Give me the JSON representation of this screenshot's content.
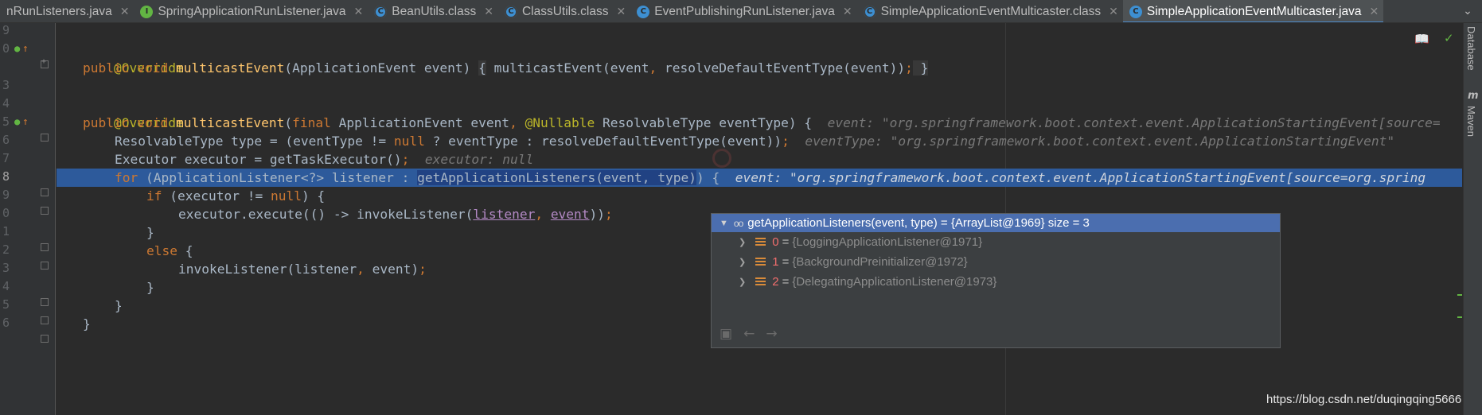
{
  "tabs": [
    {
      "label": "nRunListeners.java",
      "icon": "none"
    },
    {
      "label": "SpringApplicationRunListener.java",
      "icon": "interface-icon"
    },
    {
      "label": "BeanUtils.class",
      "icon": "class-file-icon"
    },
    {
      "label": "ClassUtils.class",
      "icon": "class-file-icon"
    },
    {
      "label": "EventPublishingRunListener.java",
      "icon": "class-icon"
    },
    {
      "label": "SimpleApplicationEventMulticaster.class",
      "icon": "class-file-icon"
    },
    {
      "label": "SimpleApplicationEventMulticaster.java",
      "icon": "class-icon",
      "active": true
    }
  ],
  "gutter": {
    "line_numbers": [
      "9",
      "0",
      "3",
      "4",
      "5",
      "6",
      "7",
      "8",
      "9",
      "0",
      "1",
      "2",
      "3",
      "4",
      "5",
      "6"
    ]
  },
  "code": {
    "l1_annotation": "@Override",
    "l2_public": "public",
    "l2_void": "void",
    "l2_name": "multicastEvent",
    "l2_sig": "(ApplicationEvent event) ",
    "l2_body_open": "{",
    "l2_body": " multicastEvent(event",
    "l2_comma": ",",
    "l2_body2": " resolveDefaultEventType(event))",
    "l2_semi": ";",
    "l2_body_close": " }",
    "l4_annotation": "@Override",
    "l5_public": "public",
    "l5_void": "void",
    "l5_name": "multicastEvent",
    "l5_open": "(",
    "l5_final": "final",
    "l5_p1": " ApplicationEvent event",
    "l5_comma": ",",
    "l5_nullable": "@Nullable",
    "l5_p2": " ResolvableType eventType) {",
    "l5_hint": "event: \"org.springframework.boot.context.event.ApplicationStartingEvent[source=",
    "l6_a": "ResolvableType type = (eventType != ",
    "l6_null": "null",
    "l6_b": " ? eventType : resolveDefaultEventType(event))",
    "l6_semi": ";",
    "l6_hint": "eventType: \"org.springframework.boot.context.event.ApplicationStartingEvent\"",
    "l7_a": "Executor executor = getTaskExecutor()",
    "l7_semi": ";",
    "l7_hint": "executor: null",
    "l8_for": "for",
    "l8_a": " (ApplicationListener<?> listener : ",
    "l8_call": "getApplicationListeners(event, type)",
    "l8_b": ") {",
    "l8_hint": "event: \"org.springframework.boot.context.event.ApplicationStartingEvent[source=org.spring",
    "l9_if": "if",
    "l9_a": " (executor != ",
    "l9_null": "null",
    "l9_b": ") {",
    "l10_a": "executor.execute(() -> invokeListener(",
    "l10_listener": "listener",
    "l10_comma": ",",
    "l10_event": "event",
    "l10_b": "))",
    "l10_semi": ";",
    "l11": "}",
    "l12_else": "else",
    "l12_b": " {",
    "l13_a": "invokeListener(listener",
    "l13_comma": ",",
    "l13_b": " event)",
    "l13_semi": ";",
    "l14": "}",
    "l15": "}",
    "l16": "}"
  },
  "debug_popup": {
    "root_expression": "getApplicationListeners(event, type) = {ArrayList@1969}  size = 3",
    "items": [
      {
        "index": "0",
        "value": "{LoggingApplicationListener@1971}"
      },
      {
        "index": "1",
        "value": "{BackgroundPreinitializer@1972}"
      },
      {
        "index": "2",
        "value": "{DelegatingApplicationListener@1973}"
      }
    ]
  },
  "right_tools": {
    "database_label": "Database",
    "maven_label": "Maven",
    "maven_icon_letter": "m"
  },
  "watermark": "https://blog.csdn.net/duqingqing5666",
  "colors": {
    "keyword": "#cc7832",
    "annotation": "#bbb529",
    "method": "#ffc66d",
    "execution_line": "#2d5a9b",
    "popup_selection": "#4b6eaf"
  }
}
